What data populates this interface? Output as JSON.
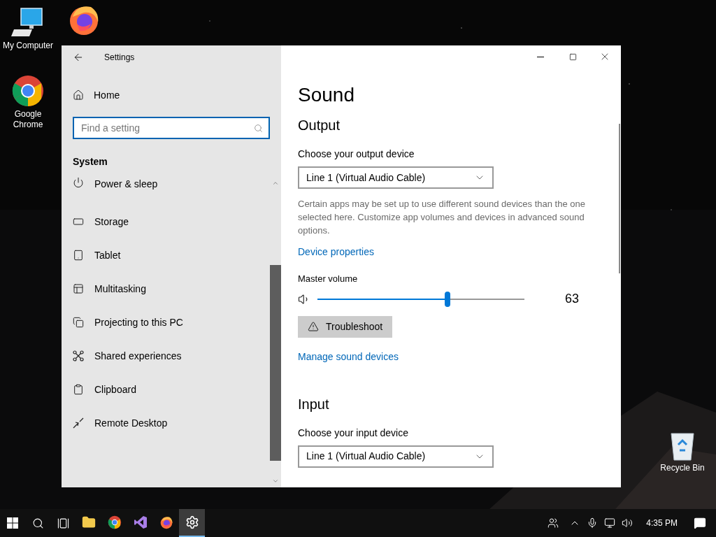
{
  "desktop_icons": [
    {
      "kind": "computer",
      "label": "My Computer"
    },
    {
      "kind": "firefox"
    },
    {
      "kind": "chrome",
      "label": "Google Chrome"
    },
    {
      "kind": "recycle",
      "label": "Recycle Bin"
    }
  ],
  "window": {
    "title": "Settings"
  },
  "sidebar": {
    "home": "Home",
    "search_placeholder": "Find a setting",
    "section": "System",
    "items": [
      {
        "kind": "power",
        "label": "Power & sleep"
      },
      {
        "kind": "storage",
        "label": "Storage"
      },
      {
        "kind": "tablet",
        "label": "Tablet"
      },
      {
        "kind": "multitasking",
        "label": "Multitasking"
      },
      {
        "kind": "projecting",
        "label": "Projecting to this PC"
      },
      {
        "kind": "shared",
        "label": "Shared experiences"
      },
      {
        "kind": "clipboard",
        "label": "Clipboard"
      },
      {
        "kind": "remote",
        "label": "Remote Desktop"
      }
    ]
  },
  "page": {
    "title": "Sound",
    "output": {
      "heading": "Output",
      "device_label": "Choose your output device",
      "device": "Line 1 (Virtual Audio Cable)",
      "note": "Certain apps may be set up to use different sound devices than the one selected here. Customize app volumes and devices in advanced sound options.",
      "properties_link": "Device properties",
      "volume_label": "Master volume",
      "volume": {
        "level": 0.63,
        "reading": "63"
      },
      "troubleshoot": "Troubleshoot",
      "manage_link": "Manage sound devices"
    },
    "input": {
      "heading": "Input",
      "device_label": "Choose your input device",
      "device": "Line 1 (Virtual Audio Cable)"
    }
  },
  "taskbar": {
    "apps": [
      {
        "kind": "explorer",
        "selected": false
      },
      {
        "kind": "chrome",
        "selected": false
      },
      {
        "kind": "visualstudio",
        "selected": false
      },
      {
        "kind": "firefox",
        "selected": false
      },
      {
        "kind": "settings",
        "selected": true
      }
    ],
    "clock": "4:35 PM"
  }
}
